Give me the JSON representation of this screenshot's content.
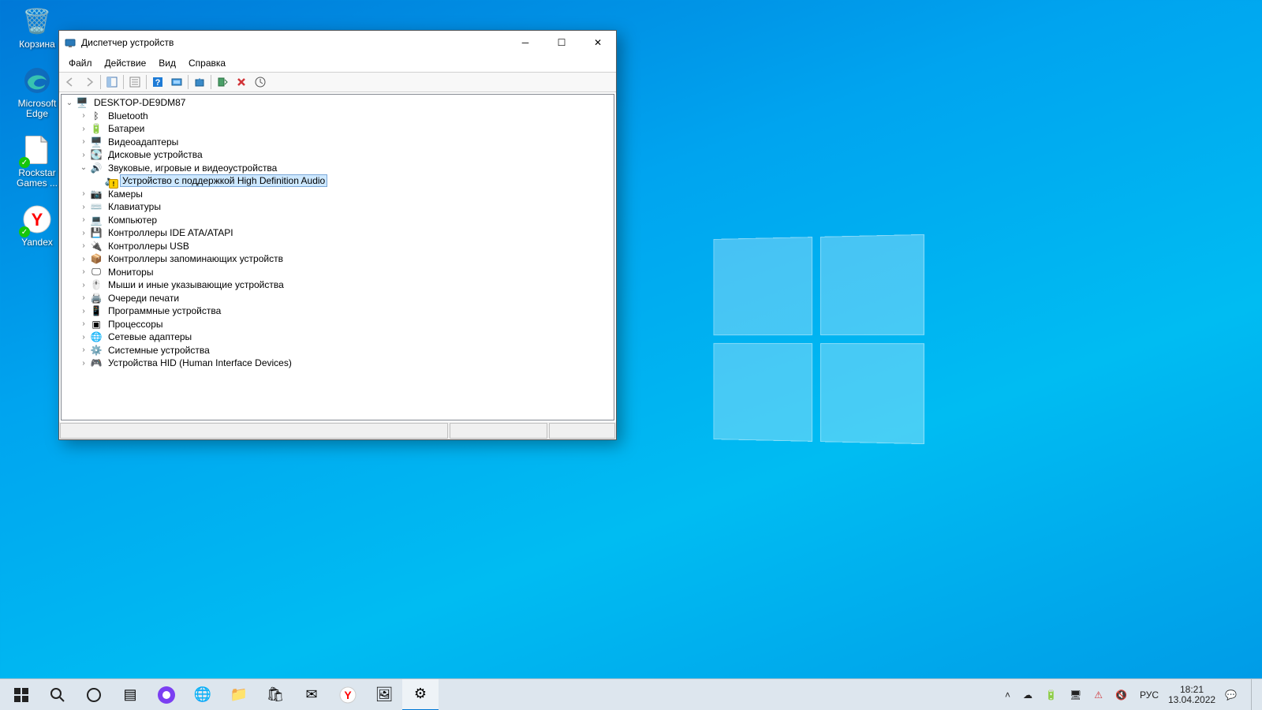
{
  "desktop": {
    "icons": [
      {
        "name": "recycle-bin",
        "label": "Корзина",
        "glyph": "🗑️"
      },
      {
        "name": "edge",
        "label": "Microsoft Edge",
        "glyph": "🌐"
      },
      {
        "name": "rockstar",
        "label": "Rockstar Games ...",
        "glyph": "📄"
      },
      {
        "name": "yandex",
        "label": "Yandex",
        "glyph": "🟡"
      }
    ]
  },
  "window": {
    "title": "Диспетчер устройств",
    "menus": [
      "Файл",
      "Действие",
      "Вид",
      "Справка"
    ],
    "toolbar": {
      "back": "back-icon",
      "forward": "forward-icon",
      "show_hide": "show-hide-tree-icon",
      "help": "help-icon",
      "properties": "properties-icon",
      "scan": "scan-hardware-icon",
      "update_driver": "update-driver-icon",
      "uninstall": "uninstall-device-icon",
      "enable": "enable-device-icon"
    },
    "tree": {
      "root": "DESKTOP-DE9DM87",
      "items": [
        {
          "label": "Bluetooth",
          "icon": "bluetooth-icon"
        },
        {
          "label": "Батареи",
          "icon": "battery-icon"
        },
        {
          "label": "Видеоадаптеры",
          "icon": "display-adapter-icon"
        },
        {
          "label": "Дисковые устройства",
          "icon": "disk-icon"
        },
        {
          "label": "Звуковые, игровые и видеоустройства",
          "icon": "sound-icon",
          "expanded": true,
          "children": [
            {
              "label": "Устройство с поддержкой High Definition Audio",
              "icon": "speaker-icon",
              "warning": true,
              "selected": true
            }
          ]
        },
        {
          "label": "Камеры",
          "icon": "camera-icon"
        },
        {
          "label": "Клавиатуры",
          "icon": "keyboard-icon"
        },
        {
          "label": "Компьютер",
          "icon": "computer-icon"
        },
        {
          "label": "Контроллеры IDE ATA/ATAPI",
          "icon": "ide-controller-icon"
        },
        {
          "label": "Контроллеры USB",
          "icon": "usb-icon"
        },
        {
          "label": "Контроллеры запоминающих устройств",
          "icon": "storage-controller-icon"
        },
        {
          "label": "Мониторы",
          "icon": "monitor-icon"
        },
        {
          "label": "Мыши и иные указывающие устройства",
          "icon": "mouse-icon"
        },
        {
          "label": "Очереди печати",
          "icon": "printer-icon"
        },
        {
          "label": "Программные устройства",
          "icon": "software-device-icon"
        },
        {
          "label": "Процессоры",
          "icon": "processor-icon"
        },
        {
          "label": "Сетевые адаптеры",
          "icon": "network-adapter-icon"
        },
        {
          "label": "Системные устройства",
          "icon": "system-device-icon"
        },
        {
          "label": "Устройства HID (Human Interface Devices)",
          "icon": "hid-icon"
        }
      ]
    }
  },
  "taskbar": {
    "buttons": [
      {
        "name": "start",
        "glyph": "⊞"
      },
      {
        "name": "search",
        "glyph": "⌕"
      },
      {
        "name": "task-view",
        "glyph": "▭"
      },
      {
        "name": "widgets",
        "glyph": "▤"
      },
      {
        "name": "alice",
        "glyph": "●"
      },
      {
        "name": "edge",
        "glyph": "🌐"
      },
      {
        "name": "explorer",
        "glyph": "📁"
      },
      {
        "name": "store",
        "glyph": "🛍"
      },
      {
        "name": "mail",
        "glyph": "✉"
      },
      {
        "name": "yandex-browser",
        "glyph": "Y"
      },
      {
        "name": "photos",
        "glyph": "🖼"
      },
      {
        "name": "device-manager",
        "glyph": "⚙",
        "active": true
      }
    ],
    "tray": {
      "chevron": "˄",
      "icons": [
        "onedrive-icon",
        "battery-icon",
        "monitor-icon",
        "network-warning-icon",
        "volume-mute-icon"
      ],
      "language": "РУС",
      "time": "18:21",
      "date": "13.04.2022"
    }
  }
}
